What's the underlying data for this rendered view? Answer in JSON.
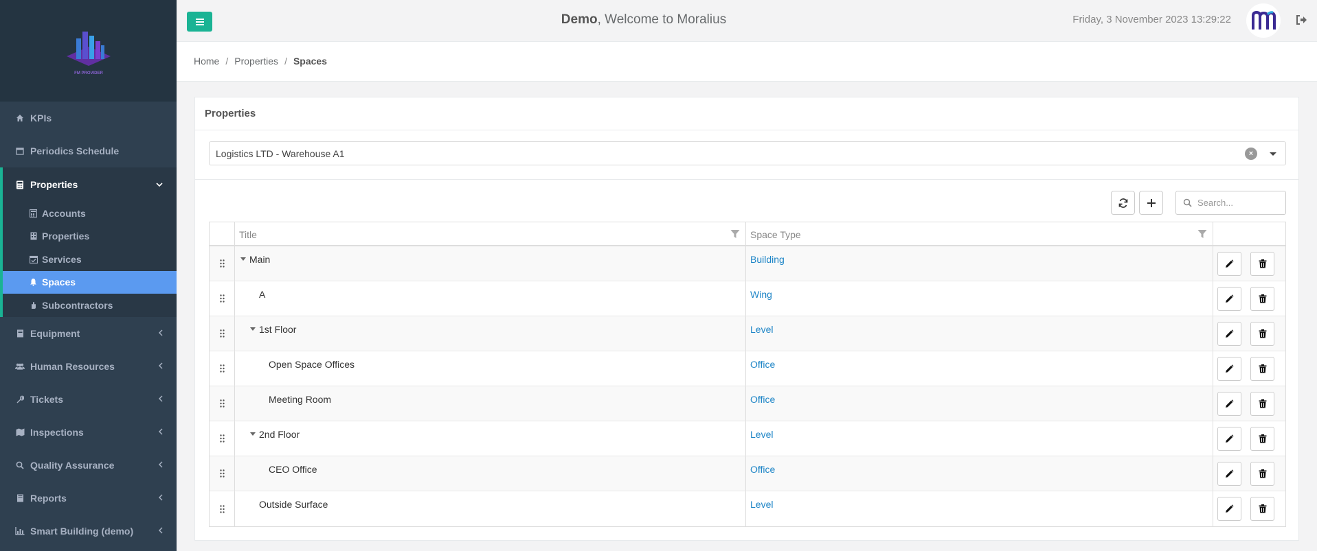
{
  "header": {
    "user": "Demo",
    "welcome_text": ", Welcome to Moralius",
    "datetime": "Friday, 3 November 2023 13:29:22"
  },
  "sidebar": {
    "items": [
      {
        "label": "KPIs",
        "icon": "home-icon"
      },
      {
        "label": "Periodics Schedule",
        "icon": "calendar-icon"
      },
      {
        "label": "Properties",
        "icon": "calculator-icon"
      },
      {
        "label": "Equipment",
        "icon": "book-icon"
      },
      {
        "label": "Human Resources",
        "icon": "users-icon"
      },
      {
        "label": "Tickets",
        "icon": "wrench-icon"
      },
      {
        "label": "Inspections",
        "icon": "map-icon"
      },
      {
        "label": "Quality Assurance",
        "icon": "search-icon"
      },
      {
        "label": "Reports",
        "icon": "book-icon"
      },
      {
        "label": "Smart Building (demo)",
        "icon": "chart-icon"
      }
    ],
    "subitems": [
      {
        "label": "Accounts",
        "icon": "calculator-icon"
      },
      {
        "label": "Properties",
        "icon": "building-icon"
      },
      {
        "label": "Services",
        "icon": "calendar-check-icon"
      },
      {
        "label": "Spaces",
        "icon": "bell-icon"
      },
      {
        "label": "Subcontractors",
        "icon": "hand-icon"
      }
    ]
  },
  "breadcrumb": {
    "home": "Home",
    "properties": "Properties",
    "current": "Spaces"
  },
  "panel": {
    "title": "Properties",
    "selected_property": "Logistics LTD - Warehouse A1"
  },
  "search": {
    "placeholder": "Search..."
  },
  "table": {
    "columns": {
      "title": "Title",
      "space_type": "Space Type"
    },
    "rows": [
      {
        "title": "Main",
        "type": "Building"
      },
      {
        "title": "A",
        "type": "Wing"
      },
      {
        "title": "1st Floor",
        "type": "Level"
      },
      {
        "title": "Open Space Offices",
        "type": "Office"
      },
      {
        "title": "Meeting Room",
        "type": "Office"
      },
      {
        "title": "2nd Floor",
        "type": "Level"
      },
      {
        "title": "CEO Office",
        "type": "Office"
      },
      {
        "title": "Outside Surface",
        "type": "Level"
      }
    ]
  },
  "colors": {
    "sidebar_bg": "#2f4050",
    "accent_green": "#1ab394",
    "active_blue": "#5b9af0",
    "link_blue": "#1c84c6"
  }
}
